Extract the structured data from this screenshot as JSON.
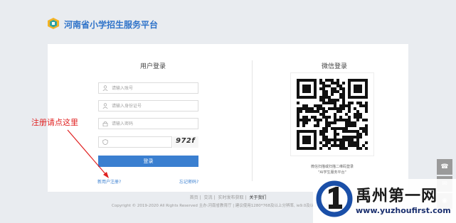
{
  "header": {
    "title": "河南省小学招生服务平台"
  },
  "login": {
    "title": "用户登录",
    "account_placeholder": "请输入账号",
    "id_placeholder": "请输入身份证号",
    "password_placeholder": "请输入密码",
    "captcha_text": "972f",
    "submit_label": "登录",
    "register_link": "新用户注册?",
    "forgot_link": "忘记密码?"
  },
  "wechat": {
    "title": "微信登录",
    "caption_line1": "微信扫描或扫描二维码登录",
    "caption_line2": "\"AI学生服务平台\""
  },
  "annotation": {
    "text": "注册请点这里"
  },
  "footer": {
    "links": [
      "首页",
      "交流",
      "实时发布获取",
      "关于我们"
    ],
    "copyright": "Copyright © 2019-2020 All Rights Reserved 主办:河南省教育厅 | 建议使用1280*768及以上分辨率, ie9.0及以上浏览器"
  },
  "side_tools": [
    "phone-icon",
    "chat-icon",
    "wechat-icon",
    "top-icon"
  ],
  "watermark": {
    "title": "禹州第一网",
    "url": "www.yuzhoufirst.com"
  },
  "colors": {
    "brand": "#2f73c9",
    "button": "#3a7fd0",
    "annotation": "#e02020"
  }
}
